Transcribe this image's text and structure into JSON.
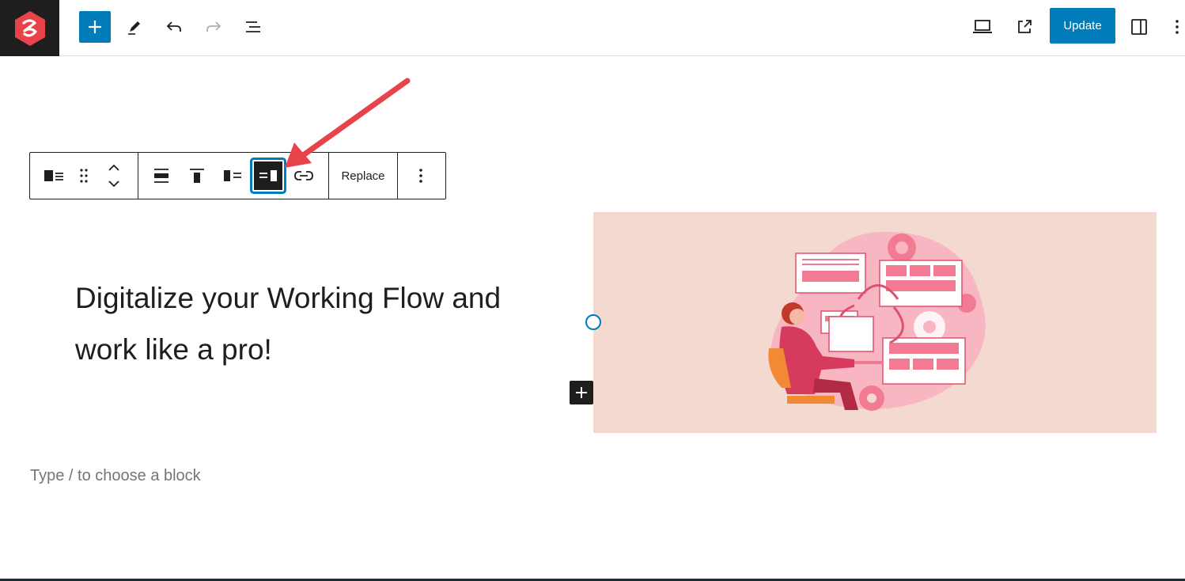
{
  "header": {
    "update_label": "Update"
  },
  "block_toolbar": {
    "replace_label": "Replace"
  },
  "content": {
    "heading_line1": "Digitalize your Working Flow and",
    "heading_line2": "work like a pro!",
    "placeholder": "Type / to choose a block"
  },
  "icons": {
    "logo": "site-logo-icon",
    "inserter": "plus-icon",
    "tools": "pencil-icon",
    "undo": "undo-icon",
    "redo": "redo-icon",
    "outline": "list-view-icon",
    "preview": "laptop-icon",
    "view_post": "external-link-icon",
    "settings": "sidebar-icon",
    "options": "more-vertical-icon"
  },
  "colors": {
    "accent": "#007cba",
    "logo_red": "#e74c3c",
    "media_bg": "#f3d9cf",
    "annotation_arrow": "#e8434a"
  }
}
